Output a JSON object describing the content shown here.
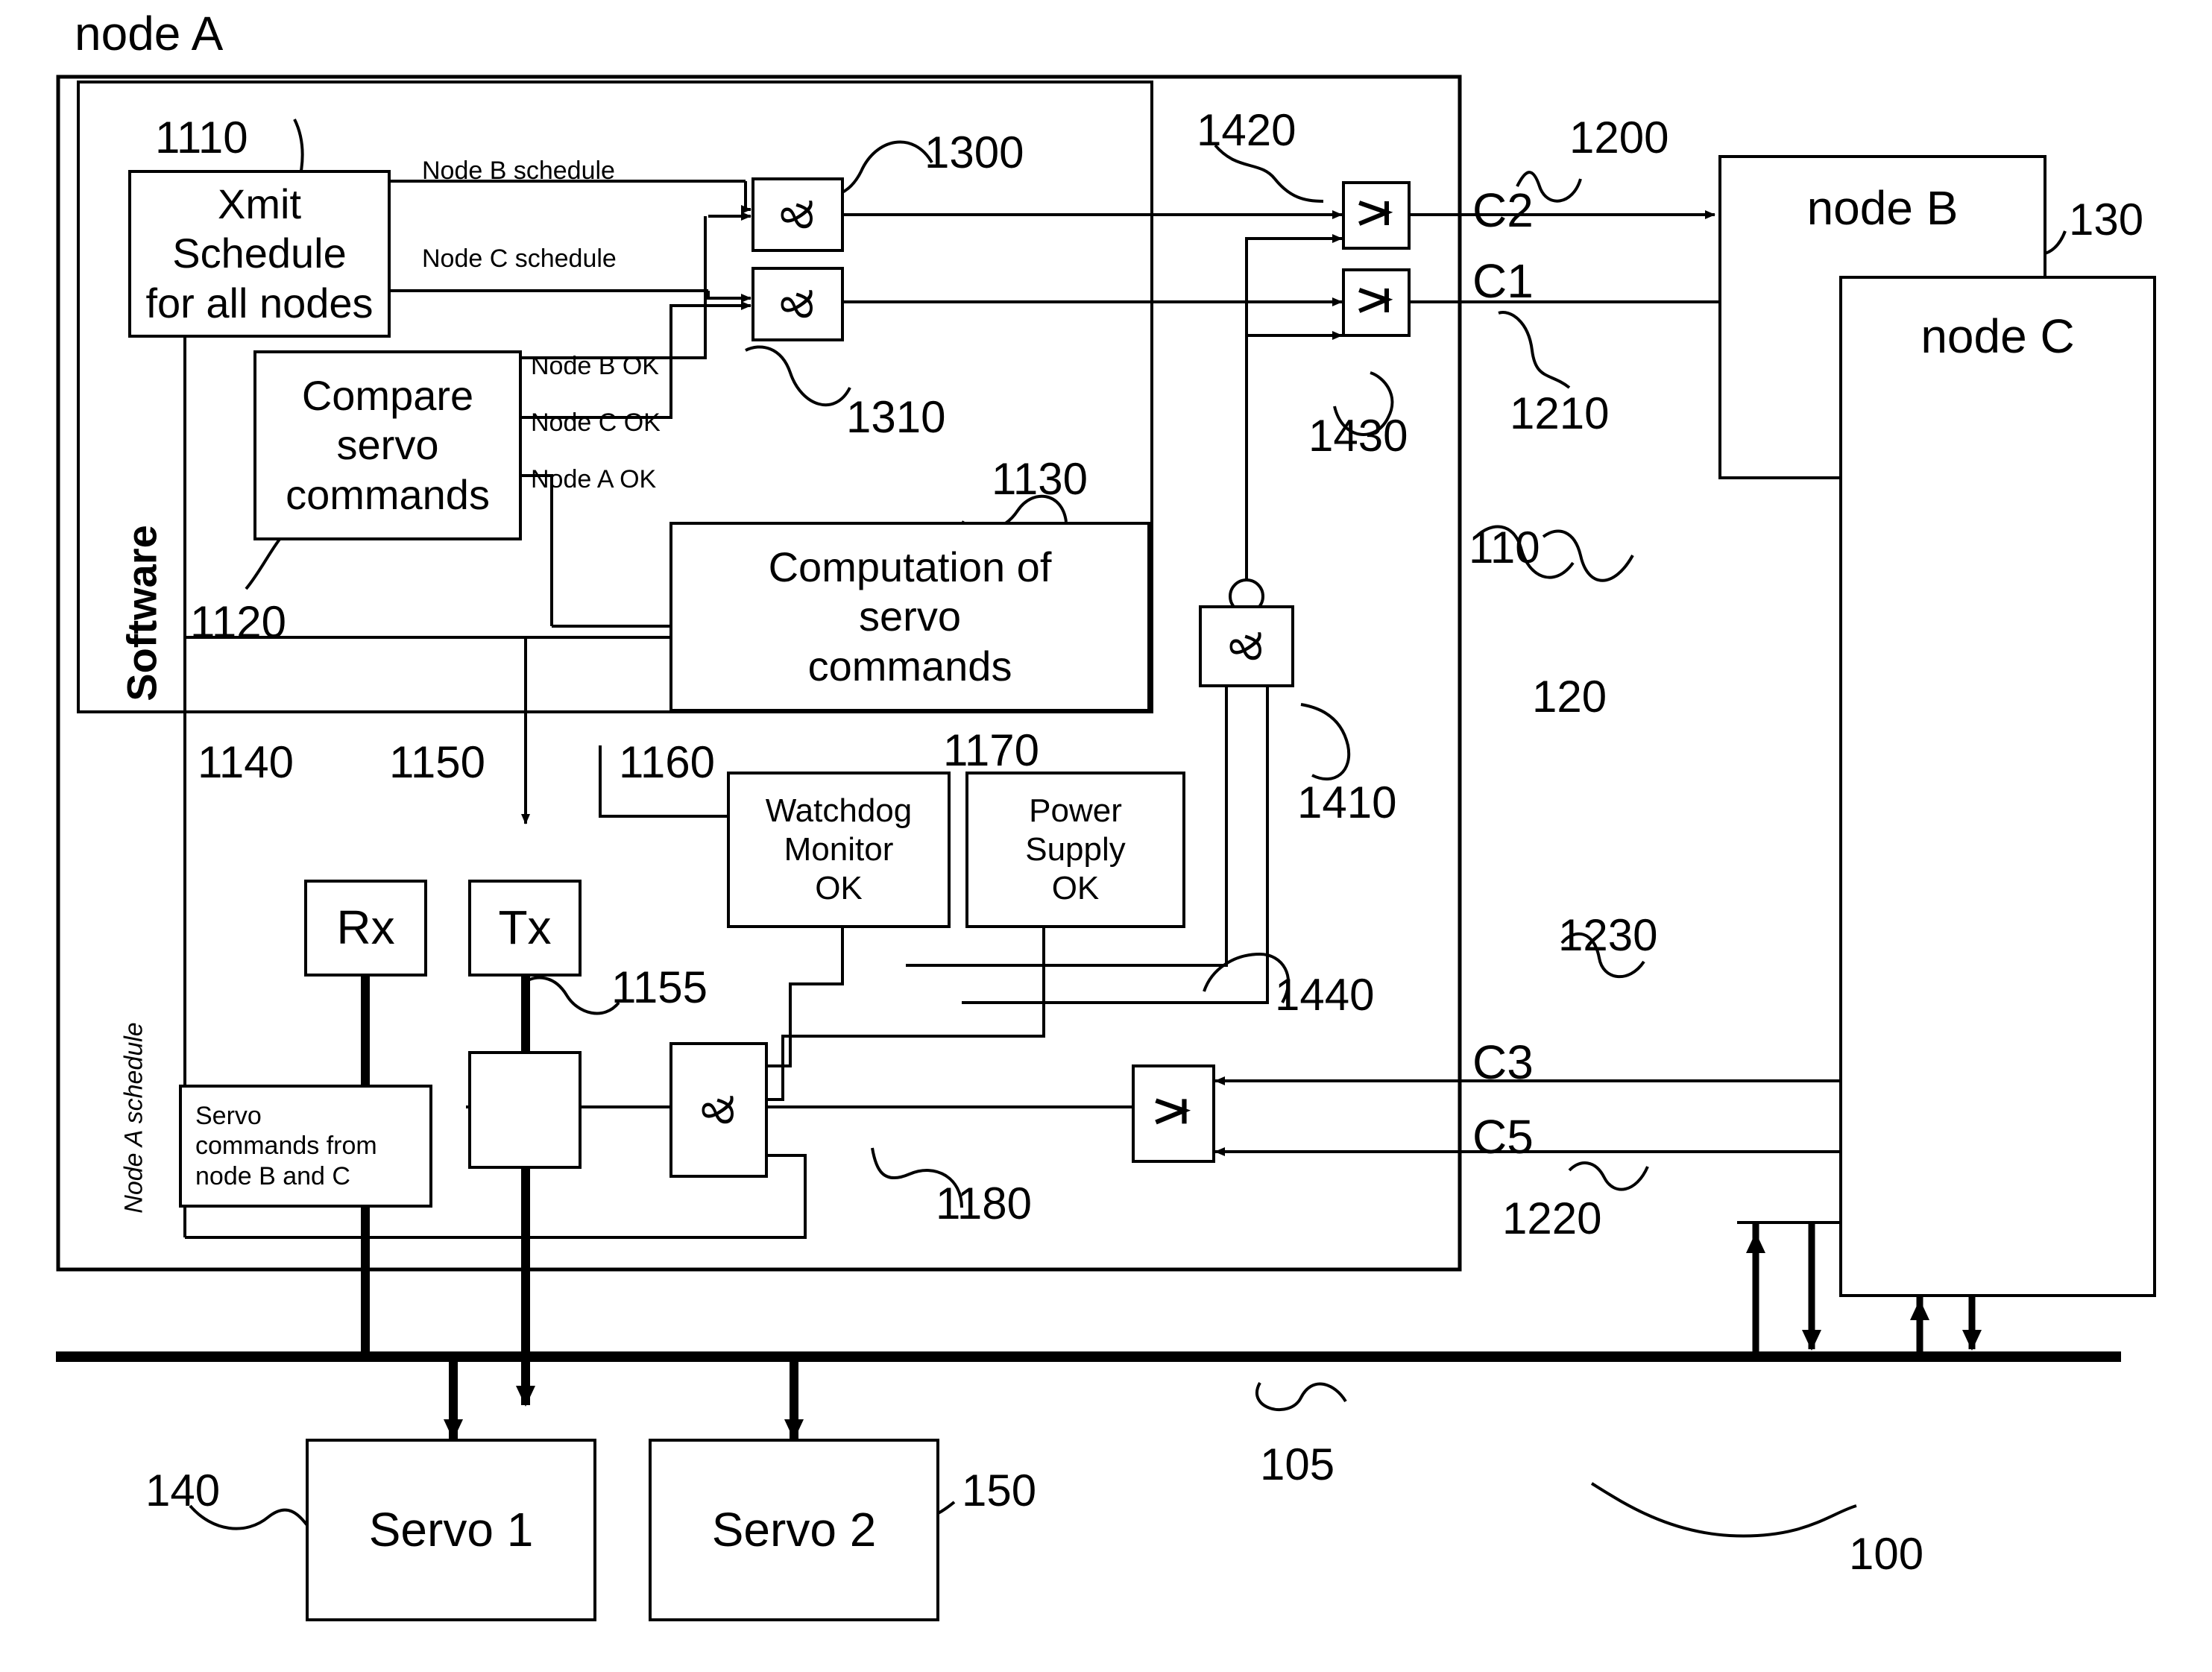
{
  "figure": {
    "title": "node A",
    "software_label": "Software",
    "node_a_schedule_label": "Node A schedule"
  },
  "blocks": {
    "xmit_schedule": "Xmit Schedule\nfor all nodes",
    "compare_servo": "Compare\nservo\ncommands",
    "computation_servo": "Computation of\nservo\ncommands",
    "watchdog": "Watchdog\nMonitor\nOK",
    "power_supply": "Power\nSupply\nOK",
    "rx": "Rx",
    "tx": "Tx",
    "servo_commands_src": "Servo\ncommands from\nnode B and C",
    "node_b": "node B",
    "node_c": "node C",
    "servo1": "Servo 1",
    "servo2": "Servo 2"
  },
  "signal_labels": {
    "node_b_schedule": "Node B schedule",
    "node_c_schedule": "Node C schedule",
    "node_b_ok": "Node B OK",
    "node_c_ok": "Node C OK",
    "node_a_ok": "Node A OK",
    "c1": "C1",
    "c2": "C2",
    "c3": "C3",
    "c5": "C5"
  },
  "gates": {
    "and_symbol": "&"
  },
  "refs": {
    "r100": "100",
    "r105": "105",
    "r110": "110",
    "r120": "120",
    "r130": "130",
    "r140": "140",
    "r150": "150",
    "r1110": "1110",
    "r1120": "1120",
    "r1130": "1130",
    "r1140": "1140",
    "r1150": "1150",
    "r1155": "1155",
    "r1160": "1160",
    "r1170": "1170",
    "r1180": "1180",
    "r1200": "1200",
    "r1210": "1210",
    "r1220": "1220",
    "r1230": "1230",
    "r1300": "1300",
    "r1310": "1310",
    "r1410": "1410",
    "r1420": "1420",
    "r1430": "1430",
    "r1440": "1440"
  },
  "colors": {
    "stroke": "#000000",
    "background": "#ffffff"
  }
}
